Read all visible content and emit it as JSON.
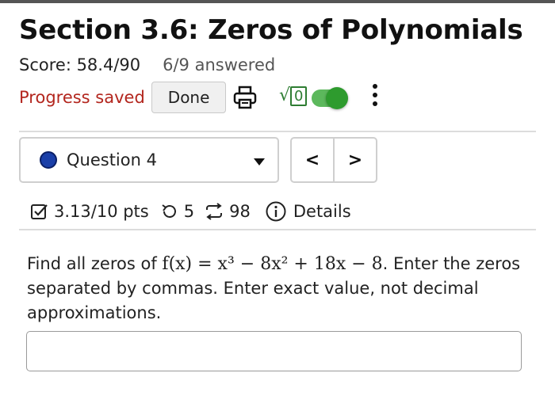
{
  "header": {
    "title": "Section 3.6: Zeros of Polynomials",
    "score": "Score: 58.4/90",
    "answered": "6/9 answered",
    "progress_saved": "Progress saved",
    "done_label": "Done",
    "sqrt_symbol": "√",
    "sqrt_box": "0"
  },
  "icons": {
    "print": "printer-icon",
    "math": "square-root-icon",
    "toggle": "toggle-switch",
    "menu": "kebab-menu-icon",
    "points": "checkbox-icon",
    "attempts": "retry-icon",
    "tries": "repeat-icon",
    "details": "info-icon"
  },
  "colors": {
    "progress_saved": "#b3261e",
    "toggle_on": "#2e9b2e",
    "question_dot": "#1a3fa8"
  },
  "question_nav": {
    "selected": "Question 4",
    "prev_label": "<",
    "next_label": ">"
  },
  "meta": {
    "points": "3.13/10 pts",
    "attempts": "5",
    "tries": "98",
    "details": "Details"
  },
  "problem": {
    "prefix": "Find all zeros of ",
    "function": "f(x) = x³ − 8x² + 18x − 8",
    "suffix": ". Enter the zeros separated by commas. Enter exact value, not decimal approximations."
  },
  "answer": {
    "value": "",
    "placeholder": ""
  }
}
